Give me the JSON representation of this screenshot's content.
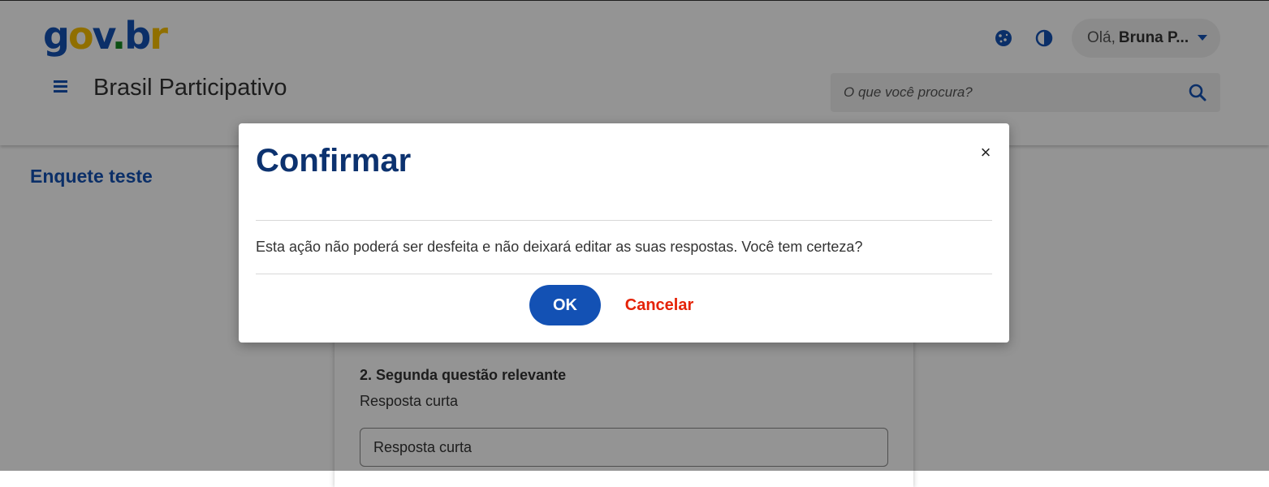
{
  "header": {
    "logo": {
      "g": "g",
      "o": "o",
      "v": "v",
      ".": ".",
      "b": "b",
      "r": "r"
    },
    "site_title": "Brasil Participativo",
    "user_greeting": "Olá,",
    "user_name": "Bruna P...",
    "search_placeholder": "O que você procura?",
    "icons": [
      "cookie-icon",
      "contrast-icon",
      "caret-down-icon",
      "menu-icon",
      "search-icon"
    ]
  },
  "page": {
    "title": "Enquete teste",
    "question": {
      "title": "2. Segunda questão relevante",
      "help": "Resposta curta",
      "input_value": "Resposta curta"
    }
  },
  "modal": {
    "title": "Confirmar",
    "close_label": "×",
    "body": "Esta ação não poderá ser desfeita e não deixará editar as suas respostas. Você tem certeza?",
    "ok_label": "OK",
    "cancel_label": "Cancelar"
  },
  "colors": {
    "primary": "#1351b4",
    "title_dark": "#0c326f",
    "danger": "#e52207",
    "logo_yellow": "#f9c000",
    "logo_green": "#168821"
  }
}
